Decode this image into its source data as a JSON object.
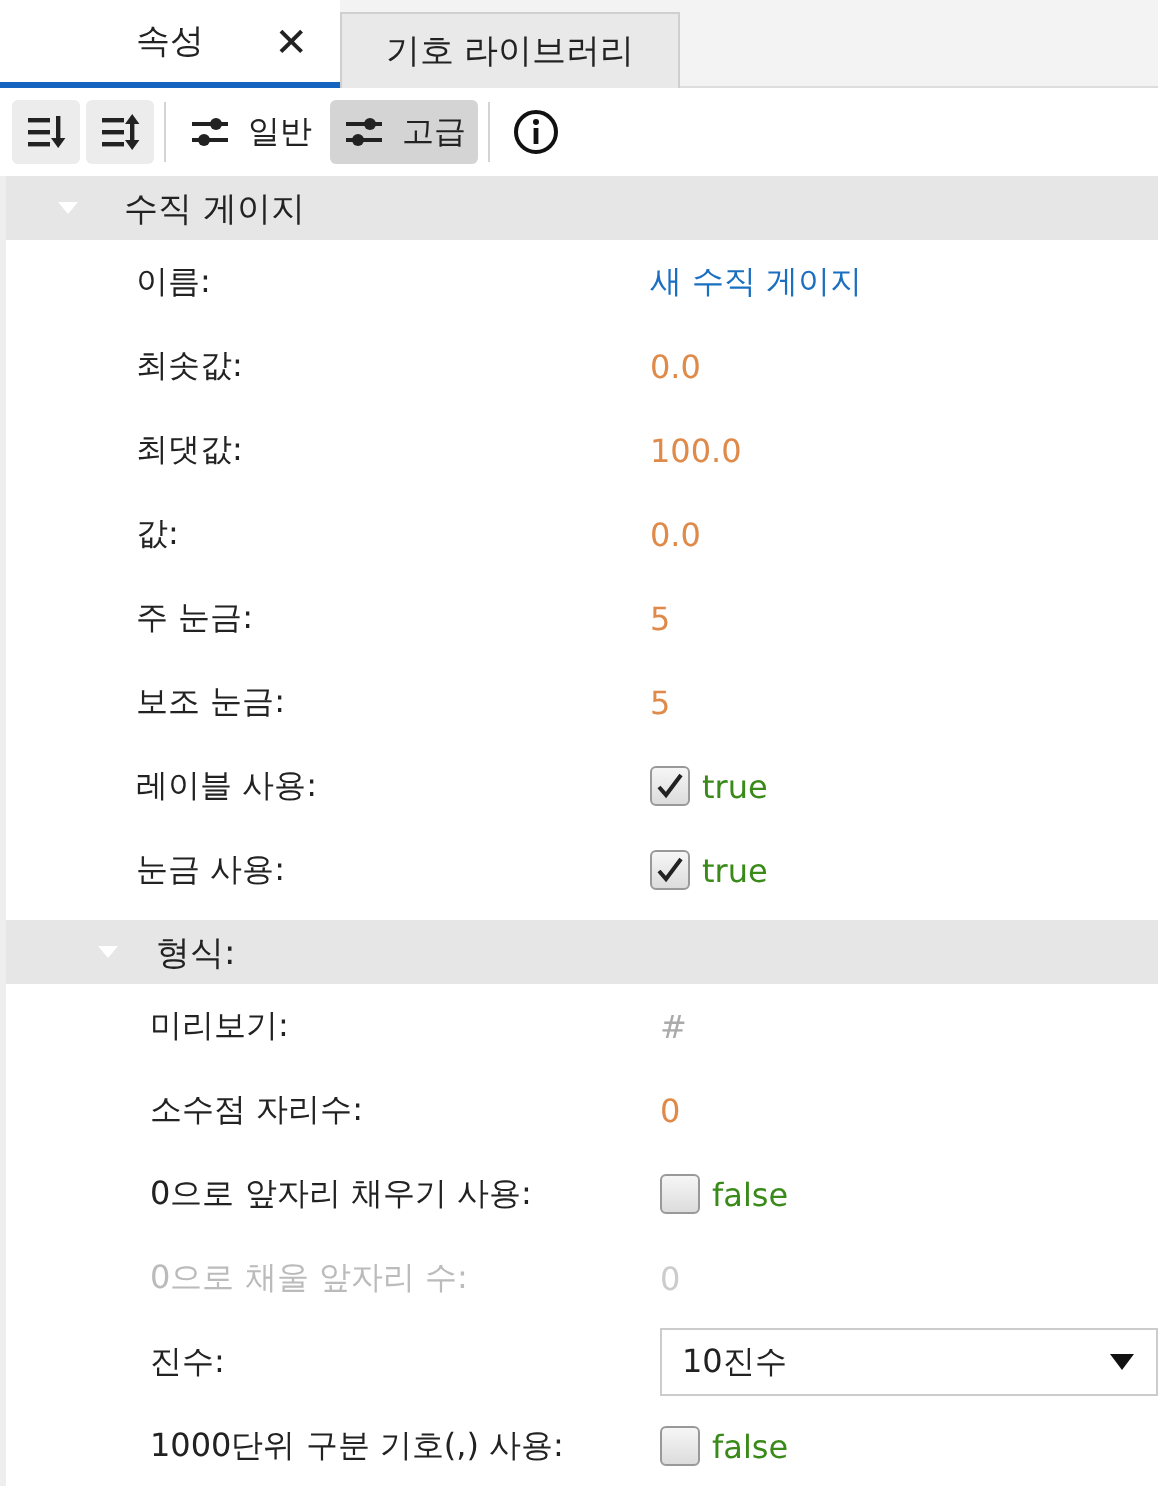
{
  "tabs": [
    {
      "label": "속성",
      "selected": true,
      "close": "✕"
    },
    {
      "label": "기호 라이브러리",
      "selected": false
    }
  ],
  "toolbar": [
    {
      "kind": "sort-desc",
      "selected": false
    },
    {
      "kind": "sort-both",
      "selected": false
    },
    {
      "kind": "separator"
    },
    {
      "kind": "sliders",
      "label": "일반",
      "selected": false
    },
    {
      "kind": "sliders",
      "label": "고급",
      "selected": true
    },
    {
      "kind": "separator"
    },
    {
      "kind": "info",
      "selected": false
    }
  ],
  "group": {
    "title": "수직 게이지",
    "expanded": true,
    "rows": [
      {
        "label": "이름:",
        "kind": "link",
        "value": "새 수직 게이지",
        "disabled": false
      },
      {
        "label": "최솟값:",
        "kind": "number",
        "value": "0.0",
        "disabled": false
      },
      {
        "label": "최댓값:",
        "kind": "number",
        "value": "100.0",
        "disabled": false
      },
      {
        "label": "값:",
        "kind": "number",
        "value": "0.0",
        "disabled": false
      },
      {
        "label": "주 눈금:",
        "kind": "number",
        "value": "5",
        "disabled": false
      },
      {
        "label": "보조 눈금:",
        "kind": "number",
        "value": "5",
        "disabled": false
      },
      {
        "label": "레이블 사용:",
        "kind": "checkbox",
        "checked": true,
        "value": "true",
        "disabled": false
      },
      {
        "label": "눈금 사용:",
        "kind": "checkbox",
        "checked": true,
        "value": "true",
        "disabled": false
      }
    ],
    "subgroup": {
      "title": "형식:",
      "expanded": true,
      "rows": [
        {
          "label": "미리보기:",
          "kind": "preview",
          "value": "#",
          "disabled": false
        },
        {
          "label": "소수점 자리수:",
          "kind": "number",
          "value": "0",
          "disabled": false
        },
        {
          "label": "0으로 앞자리 채우기 사용:",
          "kind": "checkbox",
          "checked": false,
          "value": "false",
          "disabled": false
        },
        {
          "label": "0으로 채울 앞자리 수:",
          "kind": "number",
          "value": "0",
          "disabled": true
        },
        {
          "label": "진수:",
          "kind": "dropdown",
          "value": "10진수",
          "disabled": false
        },
        {
          "label": "1000단위 구분 기호(,) 사용:",
          "kind": "checkbox",
          "checked": false,
          "value": "false",
          "disabled": false
        }
      ]
    }
  }
}
